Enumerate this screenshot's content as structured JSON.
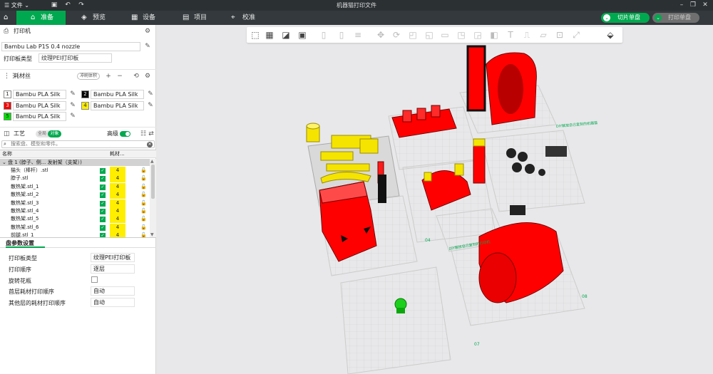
{
  "titlebar": {
    "menu_label": "☰ 文件 ⌄",
    "title": "机器猫打印文件"
  },
  "tabs": [
    {
      "label": "准备",
      "icon": "home-icon"
    },
    {
      "label": "预览",
      "icon": "cube-icon"
    },
    {
      "label": "设备",
      "icon": "grid-icon"
    },
    {
      "label": "项目",
      "icon": "book-icon"
    },
    {
      "label": "校准",
      "icon": "calibrate-icon"
    }
  ],
  "slice": {
    "slice_label": "切片单盘",
    "print_label": "打印单盘",
    "accent": "#00a94f"
  },
  "printer": {
    "section_label": "打印机",
    "preset": "Bambu Lab P1S 0.4 nozzle",
    "plate_type_label": "打印板类型",
    "plate_type": "纹理PEI打印板"
  },
  "filament": {
    "section_label": "耗材丝",
    "flush_label": "冲刷体积",
    "slots": [
      {
        "num": "1",
        "name": "Bambu PLA Silk",
        "color": "#ffffff",
        "text_color": "#222222"
      },
      {
        "num": "2",
        "name": "Bambu PLA Silk",
        "color": "#000000",
        "text_color": "#ffffff"
      },
      {
        "num": "3",
        "name": "Bambu PLA Silk",
        "color": "#ff0000",
        "text_color": "#ffffff"
      },
      {
        "num": "4",
        "name": "Bambu PLA Silk",
        "color": "#ffee00",
        "text_color": "#222222"
      },
      {
        "num": "5",
        "name": "Bambu PLA Silk",
        "color": "#00e000",
        "text_color": "#222222"
      }
    ]
  },
  "process": {
    "section_label": "工艺",
    "global_label": "全局",
    "object_label": "对象",
    "advanced_label": "高级",
    "search_placeholder": "搜索盘、模型和零件。"
  },
  "tree": {
    "col_name": "名称",
    "col_filament": "耗材...",
    "plate_label": "盘 1 (脖子、侧... 发射架（支架）)",
    "rows": [
      {
        "name": "猫头（棒杆）.stl",
        "filament": "4"
      },
      {
        "name": "脖子.stl",
        "filament": "4"
      },
      {
        "name": "散热架.stl_1",
        "filament": "4"
      },
      {
        "name": "散热架.stl_2",
        "filament": "4"
      },
      {
        "name": "散热架.stl_3",
        "filament": "4"
      },
      {
        "name": "散热架.stl_4",
        "filament": "4"
      },
      {
        "name": "散热架.stl_5",
        "filament": "4"
      },
      {
        "name": "散热架.stl_6",
        "filament": "4"
      },
      {
        "name": "前腿.stl_1",
        "filament": "4"
      }
    ]
  },
  "plate_settings": {
    "section_label": "盘参数设置",
    "items": [
      {
        "label": "打印板类型",
        "value": "纹理PEI打印板"
      },
      {
        "label": "打印顺序",
        "value": "逐层"
      },
      {
        "label": "旋转花瓶",
        "value": ""
      },
      {
        "label": "首层耗材打印顺序",
        "value": "自动"
      },
      {
        "label": "其他层的耗材打印顺序",
        "value": "自动"
      }
    ]
  },
  "plates": [
    {
      "num": "04"
    },
    {
      "num": "07"
    },
    {
      "num": "08"
    }
  ],
  "plate_captions": [
    "DIY解放自己复刻的打印机",
    "DIY解放自己复刻的机器猫"
  ]
}
